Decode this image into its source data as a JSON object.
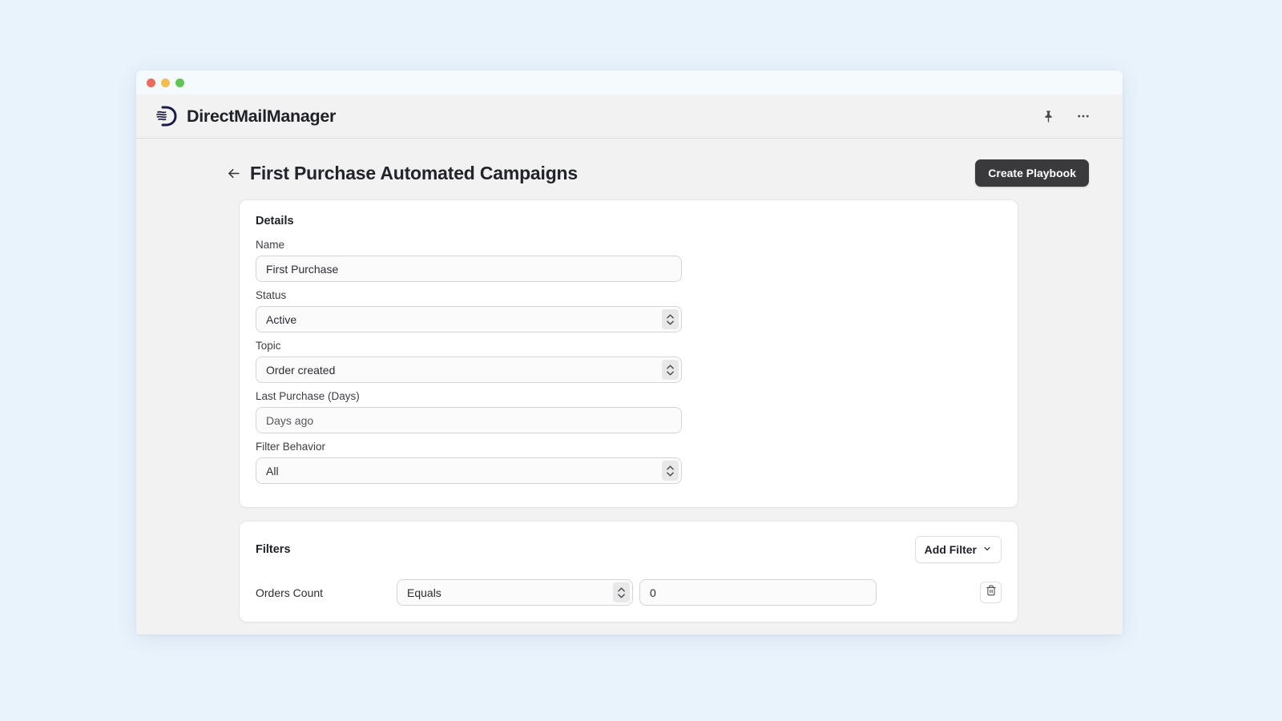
{
  "window": {
    "traffic_lights": [
      "close",
      "minimize",
      "maximize"
    ]
  },
  "header": {
    "brand_name": "DirectMailManager",
    "pin_icon": "pin-icon",
    "more_icon": "more-horizontal-icon"
  },
  "page": {
    "back_label": "←",
    "title": "First Purchase Automated Campaigns",
    "primary_button": "Create Playbook"
  },
  "details": {
    "title": "Details",
    "fields": [
      {
        "label": "Name",
        "value": "First Purchase",
        "type": "text",
        "placeholder": "Name"
      },
      {
        "label": "Status",
        "value": "Active",
        "type": "select",
        "placeholder": "Status"
      },
      {
        "label": "Topic",
        "value": "Order created",
        "type": "select",
        "placeholder": "Topic"
      },
      {
        "label": "Last Purchase (Days)",
        "value": "Days ago",
        "type": "text",
        "placeholder": "Days ago"
      },
      {
        "label": "Filter Behavior",
        "value": "All",
        "type": "select",
        "placeholder": "Filter Behavior"
      }
    ]
  },
  "filters": {
    "title": "Filters",
    "add_button": "Add Filter",
    "add_button_icon": "chevron-down-icon",
    "rows": [
      {
        "label": "Orders Count",
        "operator": "Equals",
        "value": "0",
        "delete_icon": "trash-icon"
      }
    ]
  },
  "colors": {
    "page_background": "#e9f3fc",
    "window_background": "#f2f2f2",
    "card_background": "#ffffff",
    "primary_button": "#3a3a3c",
    "brand_logo": "#1b1b4b",
    "traffic_red": "#ef6b5d",
    "traffic_yellow": "#f5bd4f",
    "traffic_green": "#61c555"
  }
}
